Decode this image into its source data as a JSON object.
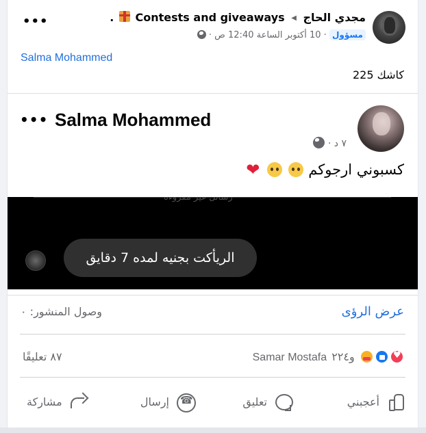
{
  "outer_post": {
    "author": "مجدي الحاج",
    "group": "Contests and giveaways",
    "trailing": ".",
    "role_badge": "مسؤول",
    "timestamp": "10 أكتوبر الساعة 12:40 ص",
    "separator": "·",
    "mention": "Salma Mohammed",
    "text": "كاشك 225",
    "more_label": "•••"
  },
  "shared_post": {
    "author": "Salma Mohammed",
    "time": "٧ د",
    "separator": "·",
    "text": "كسبوني ارجوكم",
    "more_label": "•••",
    "image": {
      "faded_text": "رسائل غير مقروءة",
      "bubble_text": "الريأكت بجنيه لمده 7 دقايق"
    }
  },
  "stats": {
    "reach": "وصول المنشور: ٠",
    "insights_link": "عرض الرؤى",
    "reaction_names": "Samar Mostafa",
    "reaction_others": "و٢٢٤",
    "comments": "٨٧ تعليقًا"
  },
  "actions": {
    "like": "أعجبني",
    "comment": "تعليق",
    "send": "إرسال",
    "share": "مشاركة"
  }
}
